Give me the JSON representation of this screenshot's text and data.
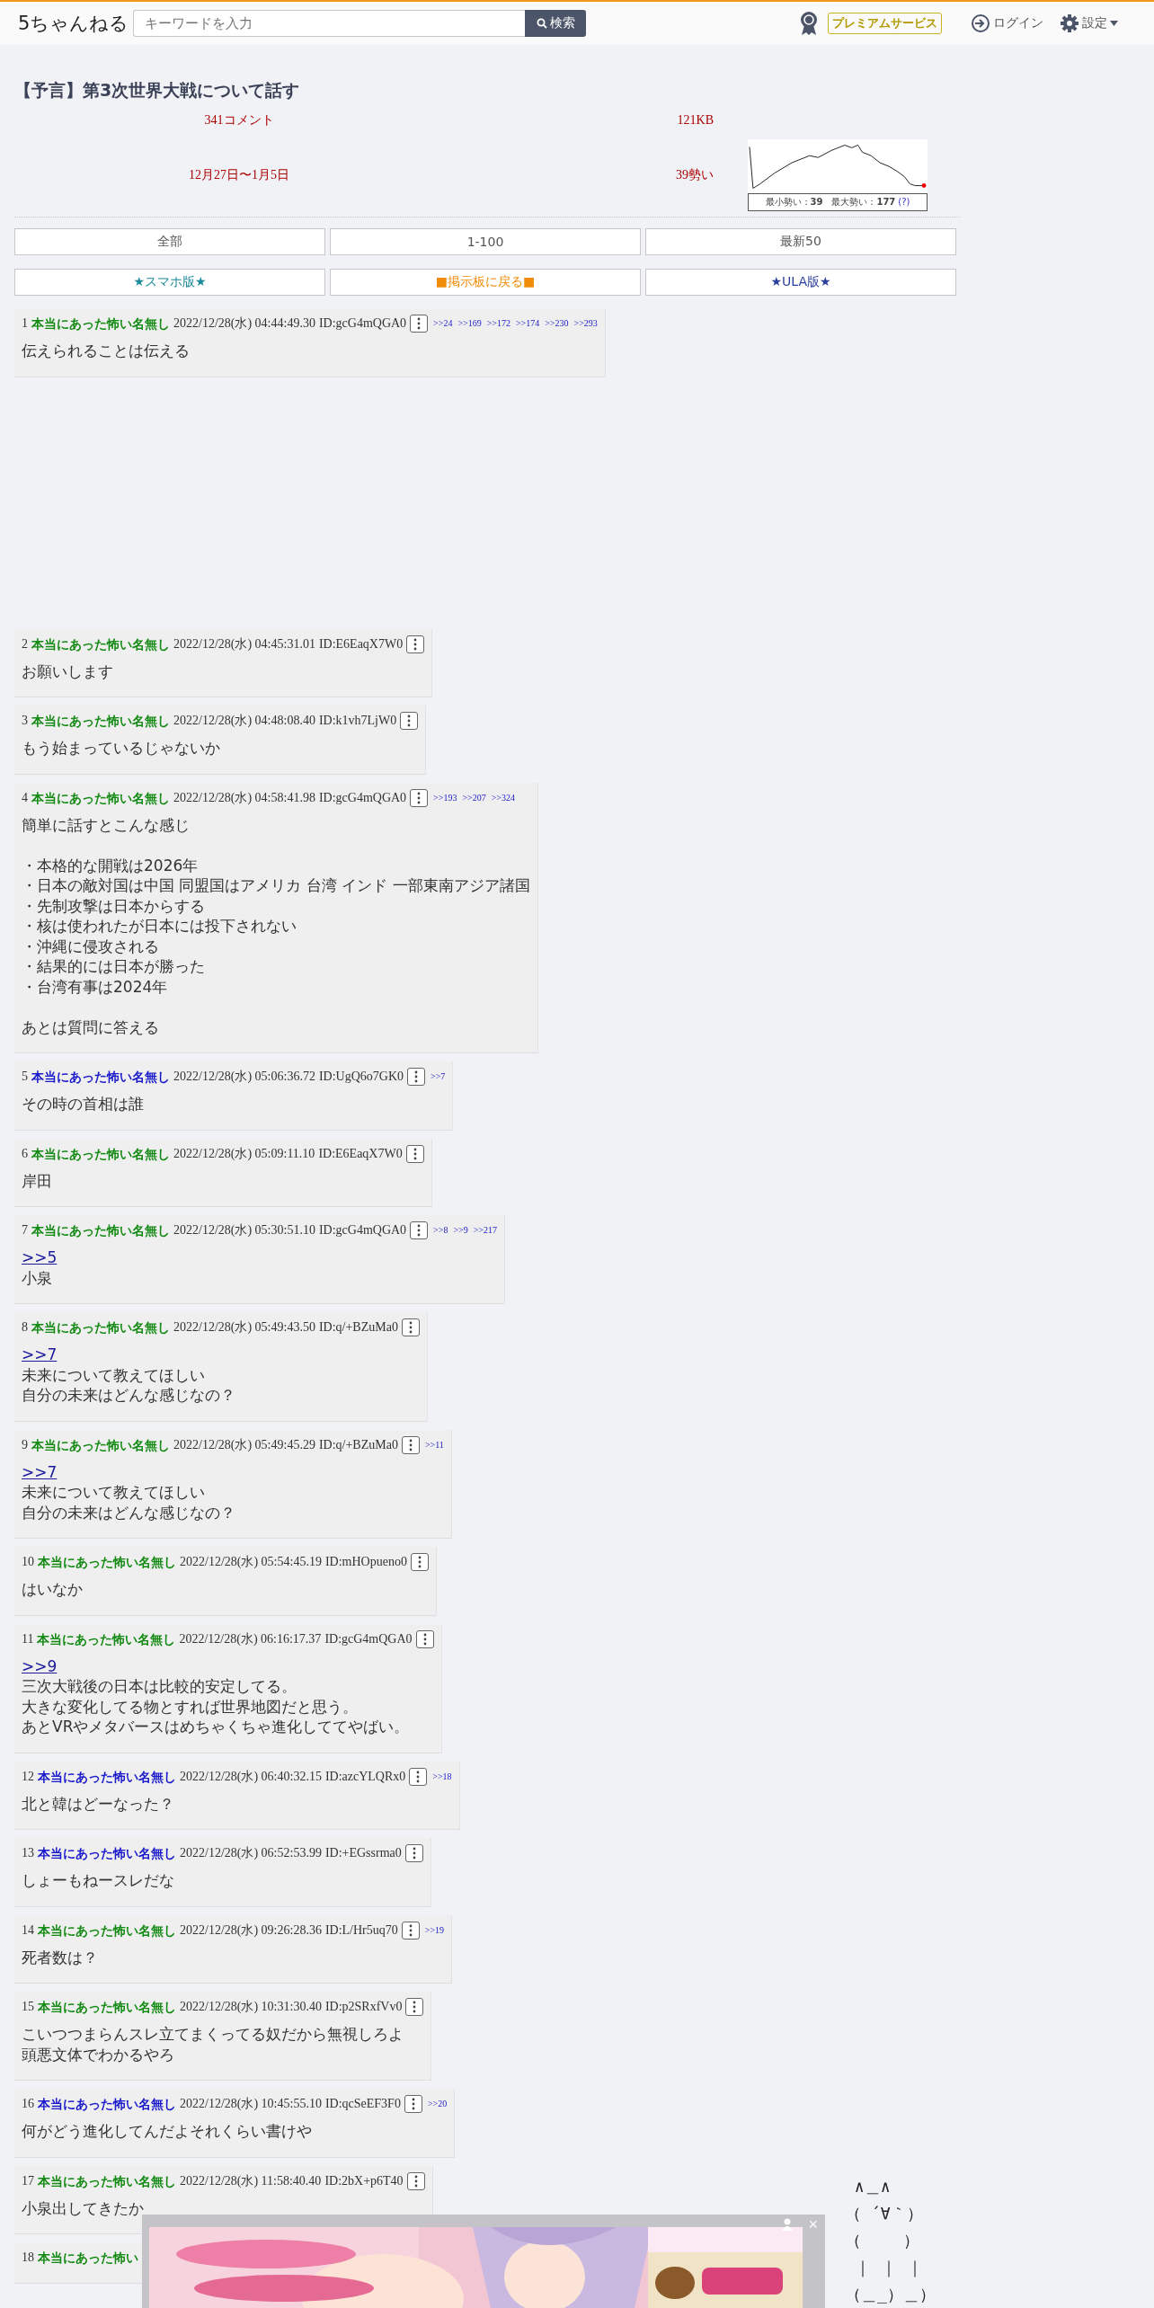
{
  "header": {
    "logo": "5ちゃんねる",
    "search": {
      "placeholder": "キーワードを入力",
      "button": "検索"
    },
    "premium": "プレミアムサービス",
    "login": "ログイン",
    "settings": "設定"
  },
  "thread": {
    "title": "【予言】第3次世界大戦について話す",
    "comments": "341コメント",
    "size": "121KB",
    "period": "12月27日〜1月5日",
    "momentum": "39勢い",
    "chart_caption": "最小勢い：**39**　最大勢い：**177**",
    "help_link": "(?)"
  },
  "nav_rows": [
    [
      {
        "label": "全部",
        "color": "#555555"
      },
      {
        "label": "1-100",
        "color": "#555555"
      },
      {
        "label": "最新50",
        "color": "#555555"
      }
    ],
    [
      {
        "label": "★スマホ版★",
        "color": "#1b8a9a"
      },
      {
        "label": "■掲示板に戻る■",
        "color": "#f08c0a"
      },
      {
        "label": "★ULA版★",
        "color": "#2b3f9c"
      }
    ]
  ],
  "posts": [
    {
      "number": "1",
      "name": "本当にあった怖い名無し",
      "color": "#138a13",
      "date": "2022/12/28(水) 04:44:49.30",
      "id": "ID:gcG4mQGA0",
      "replies": [
        ">>24",
        ">>169",
        ">>172",
        ">>174",
        ">>230",
        ">>293"
      ],
      "paragraphs": [
        [
          "伝えられることは伝える"
        ]
      ]
    },
    {
      "number": "2",
      "name": "本当にあった怖い名無し",
      "color": "#138a13",
      "date": "2022/12/28(水) 04:45:31.01",
      "id": "ID:E6EaqX7W0",
      "paragraphs": [
        [
          "お願いします"
        ]
      ]
    },
    {
      "number": "3",
      "name": "本当にあった怖い名無し",
      "color": "#138a13",
      "date": "2022/12/28(水) 04:48:08.40",
      "id": "ID:k1vh7LjW0",
      "paragraphs": [
        [
          "もう始まっているじゃないか"
        ]
      ]
    },
    {
      "number": "4",
      "name": "本当にあった怖い名無し",
      "color": "#138a13",
      "date": "2022/12/28(水) 04:58:41.98",
      "id": "ID:gcG4mQGA0",
      "replies": [
        ">>193",
        ">>207",
        ">>324"
      ],
      "paragraphs": [
        [
          "簡単に話すとこんな感じ"
        ],
        [
          "・本格的な開戦は2026年",
          "・日本の敵対国は中国 同盟国はアメリカ 台湾 インド 一部東南アジア諸国",
          "・先制攻撃は日本からする",
          "・核は使われたが日本には投下されない",
          "・沖縄に侵攻される",
          "・結果的には日本が勝った",
          "・台湾有事は2024年"
        ],
        [
          "あとは質問に答える"
        ]
      ]
    },
    {
      "number": "5",
      "name": "本当にあった怖い名無し",
      "color": "#1a1acc",
      "date": "2022/12/28(水) 05:06:36.72",
      "id": "ID:UgQ6o7GK0",
      "replies": [
        ">>7"
      ],
      "paragraphs": [
        [
          "その時の首相は誰"
        ]
      ]
    },
    {
      "number": "6",
      "name": "本当にあった怖い名無し",
      "color": "#138a13",
      "date": "2022/12/28(水) 05:09:11.10",
      "id": "ID:E6EaqX7W0",
      "paragraphs": [
        [
          "岸田"
        ]
      ]
    },
    {
      "number": "7",
      "name": "本当にあった怖い名無し",
      "color": "#138a13",
      "date": "2022/12/28(水) 05:30:51.10",
      "id": "ID:gcG4mQGA0",
      "replies": [
        ">>8",
        ">>9",
        ">>217"
      ],
      "anchor": ">>5",
      "paragraphs": [
        [
          "小泉"
        ]
      ]
    },
    {
      "number": "8",
      "name": "本当にあった怖い名無し",
      "color": "#138a13",
      "date": "2022/12/28(水) 05:49:43.50",
      "id": "ID:q/+BZuMa0",
      "anchor": ">>7",
      "paragraphs": [
        [
          "未来について教えてほしい",
          "自分の未来はどんな感じなの？"
        ]
      ]
    },
    {
      "number": "9",
      "name": "本当にあった怖い名無し",
      "color": "#138a13",
      "date": "2022/12/28(水) 05:49:45.29",
      "id": "ID:q/+BZuMa0",
      "replies": [
        ">>11"
      ],
      "anchor": ">>7",
      "paragraphs": [
        [
          "未来について教えてほしい",
          "自分の未来はどんな感じなの？"
        ]
      ]
    },
    {
      "number": "10",
      "name": "本当にあった怖い名無し",
      "color": "#138a13",
      "date": "2022/12/28(水) 05:54:45.19",
      "id": "ID:mHOpueno0",
      "paragraphs": [
        [
          "はいなか"
        ]
      ]
    },
    {
      "number": "11",
      "name": "本当にあった怖い名無し",
      "color": "#138a13",
      "date": "2022/12/28(水) 06:16:17.37",
      "id": "ID:gcG4mQGA0",
      "anchor": ">>9",
      "paragraphs": [
        [
          "三次大戦後の日本は比較的安定してる。",
          "大きな変化してる物とすれば世界地図だと思う。",
          "あとVRやメタバースはめちゃくちゃ進化しててやばい。"
        ]
      ]
    },
    {
      "number": "12",
      "name": "本当にあった怖い名無し",
      "color": "#1a1acc",
      "date": "2022/12/28(水) 06:40:32.15",
      "id": "ID:azcYLQRx0",
      "replies": [
        ">>18"
      ],
      "paragraphs": [
        [
          "北と韓はどーなった？"
        ]
      ]
    },
    {
      "number": "13",
      "name": "本当にあった怖い名無し",
      "color": "#1a1acc",
      "date": "2022/12/28(水) 06:52:53.99",
      "id": "ID:+EGssrma0",
      "paragraphs": [
        [
          "しょーもねースレだな"
        ]
      ]
    },
    {
      "number": "14",
      "name": "本当にあった怖い名無し",
      "color": "#138a13",
      "date": "2022/12/28(水) 09:26:28.36",
      "id": "ID:L/Hr5uq70",
      "replies": [
        ">>19"
      ],
      "paragraphs": [
        [
          "死者数は？"
        ]
      ]
    },
    {
      "number": "15",
      "name": "本当にあった怖い名無し",
      "color": "#138a13",
      "date": "2022/12/28(水) 10:31:30.40",
      "id": "ID:p2SRxfVv0",
      "paragraphs": [
        [
          "こいつつまらんスレ立てまくってる奴だから無視しろよ",
          "頭悪文体でわかるやろ"
        ]
      ]
    },
    {
      "number": "16",
      "name": "本当にあった怖い名無し",
      "color": "#1a1acc",
      "date": "2022/12/28(水) 10:45:55.10",
      "id": "ID:qcSeEF3F0",
      "replies": [
        ">>20"
      ],
      "paragraphs": [
        [
          "何がどう進化してんだよそれくらい書けや"
        ]
      ]
    },
    {
      "number": "17",
      "name": "本当にあった怖い名無し",
      "color": "#138a13",
      "date": "2022/12/28(水) 11:58:40.40",
      "id": "ID:2bX+p6T40",
      "paragraphs": [
        [
          "小泉出してきたか"
        ]
      ]
    },
    {
      "number": "18",
      "name": "本当にあった怖い",
      "color": "#138a13"
    }
  ],
  "ad_banner": {
    "kind": "picture",
    "close": "×"
  },
  "ascii_art": [
    " ∧＿∧",
    "（ ´∀｀）",
    "（　　 ）",
    " ｜ ｜ ｜",
    "（＿_）＿）"
  ]
}
